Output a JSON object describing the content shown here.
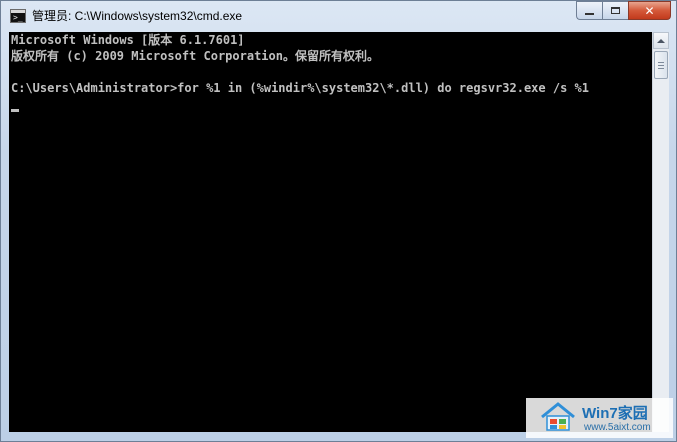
{
  "window": {
    "title": "管理员: C:\\Windows\\system32\\cmd.exe",
    "icon": "cmd-console-icon",
    "icon_glyph": ">_",
    "buttons": {
      "minimize": "minimize-icon",
      "maximize": "maximize-icon",
      "close": "close-icon",
      "close_glyph": "✕"
    }
  },
  "console": {
    "lines": [
      "Microsoft Windows [版本 6.1.7601]",
      "版权所有 (c) 2009 Microsoft Corporation。保留所有权利。",
      "",
      "C:\\Users\\Administrator>for %1 in (%windir%\\system32\\*.dll) do regsvr32.exe /s %1"
    ],
    "text_color": "#c0c0c0",
    "background": "#000000"
  },
  "watermark": {
    "title": "Win7家园",
    "url": "www.5aixt.com"
  }
}
